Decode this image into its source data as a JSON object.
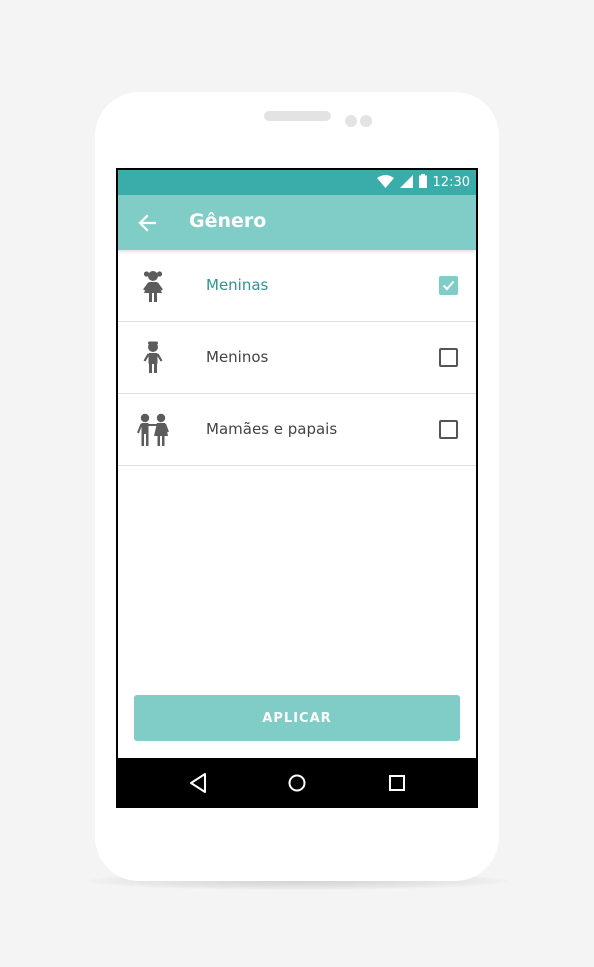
{
  "status_bar": {
    "time": "12:30",
    "icons": [
      "wifi-icon",
      "signal-icon",
      "battery-icon"
    ]
  },
  "app_bar": {
    "back_icon": "arrow-left-icon",
    "title": "Gênero"
  },
  "options": [
    {
      "label": "Meninas",
      "icon": "girl-icon",
      "checked": true
    },
    {
      "label": "Meninos",
      "icon": "boy-icon",
      "checked": false
    },
    {
      "label": "Mamães e papais",
      "icon": "couple-icon",
      "checked": false
    }
  ],
  "apply_button": {
    "label": "APLICAR"
  },
  "nav_bar": {
    "icons": [
      "nav-back-icon",
      "nav-home-icon",
      "nav-recents-icon"
    ]
  },
  "colors": {
    "status_bar": "#3aadaa",
    "primary": "#80ccc7",
    "active_text": "#2e9690",
    "text": "#444444",
    "icon": "#5c5c5c"
  }
}
